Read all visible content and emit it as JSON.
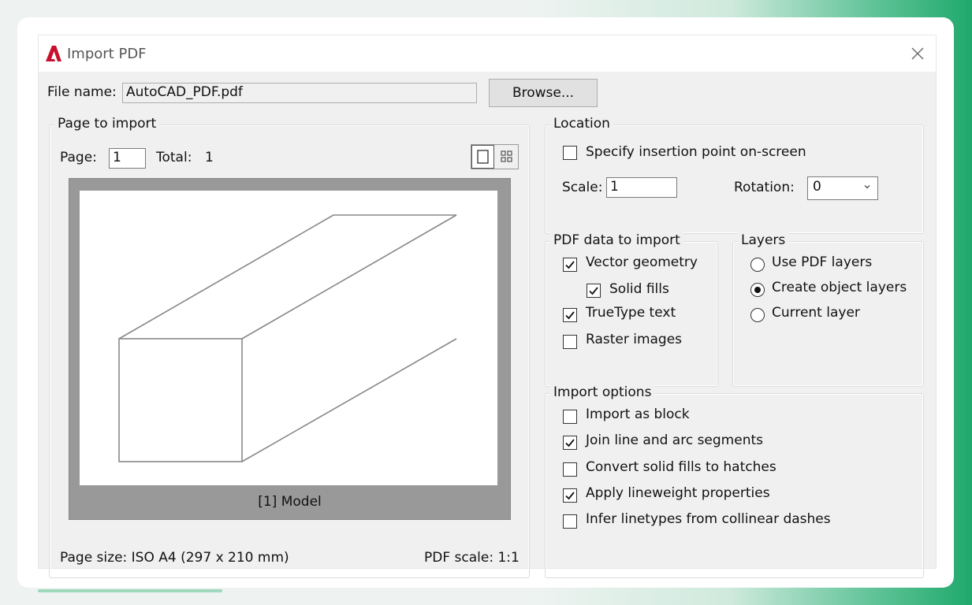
{
  "window": {
    "title": "Import PDF"
  },
  "file": {
    "label": "File name:",
    "value": "AutoCAD_PDF.pdf",
    "browse_label": "Browse..."
  },
  "page_to_import": {
    "legend": "Page to import",
    "page_label": "Page:",
    "page_value": "1",
    "total_label": "Total:",
    "total_value": "1",
    "preview_caption": "[1] Model",
    "page_size": "Page size: ISO A4 (297 x 210 mm)",
    "pdf_scale": "PDF scale: 1:1"
  },
  "location": {
    "legend": "Location",
    "specify_label": "Specify insertion point on-screen",
    "specify_checked": false,
    "scale_label": "Scale:",
    "scale_value": "1",
    "rotation_label": "Rotation:",
    "rotation_value": "0"
  },
  "pdf_data": {
    "legend": "PDF data to import",
    "items": [
      {
        "label": "Vector geometry",
        "checked": true
      },
      {
        "label": "Solid fills",
        "checked": true
      },
      {
        "label": "TrueType text",
        "checked": true
      },
      {
        "label": "Raster images",
        "checked": false
      }
    ]
  },
  "layers": {
    "legend": "Layers",
    "options": [
      {
        "label": "Use PDF layers",
        "selected": false
      },
      {
        "label": "Create object layers",
        "selected": true
      },
      {
        "label": "Current layer",
        "selected": false
      }
    ]
  },
  "import_options": {
    "legend": "Import options",
    "items": [
      {
        "label": "Import as block",
        "checked": false
      },
      {
        "label": "Join line and arc segments",
        "checked": true
      },
      {
        "label": "Convert solid fills to hatches",
        "checked": false
      },
      {
        "label": "Apply lineweight properties",
        "checked": true
      },
      {
        "label": "Infer linetypes from collinear dashes",
        "checked": false
      }
    ]
  },
  "icons": {
    "app": "autocad-logo-icon",
    "close": "close-icon",
    "single_page": "single-page-icon",
    "grid_view": "grid-view-icon"
  },
  "colors": {
    "logo_red": "#c8102e",
    "accent_green": "#1fa96c"
  }
}
